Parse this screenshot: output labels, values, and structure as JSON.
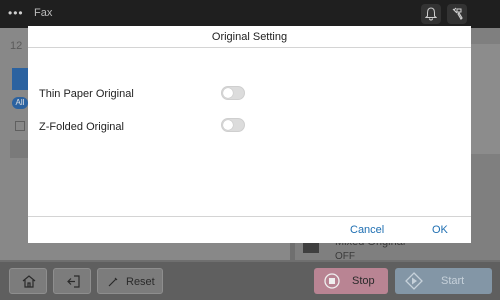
{
  "topbar": {
    "title": "Fax"
  },
  "background": {
    "number_prefix": "12",
    "pill_label": "All",
    "mixed_original": {
      "label": "Mixed Original",
      "value": "OFF"
    }
  },
  "dialog": {
    "title": "Original Setting",
    "options": [
      {
        "label": "Thin Paper Original",
        "enabled": false
      },
      {
        "label": "Z-Folded Original",
        "enabled": false
      }
    ],
    "cancel_label": "Cancel",
    "ok_label": "OK"
  },
  "bottombar": {
    "reset_label": "Reset",
    "stop_label": "Stop",
    "start_label": "Start"
  },
  "colors": {
    "accent": "#1f6fb2",
    "stop": "#b98493",
    "start": "#8396a6"
  }
}
